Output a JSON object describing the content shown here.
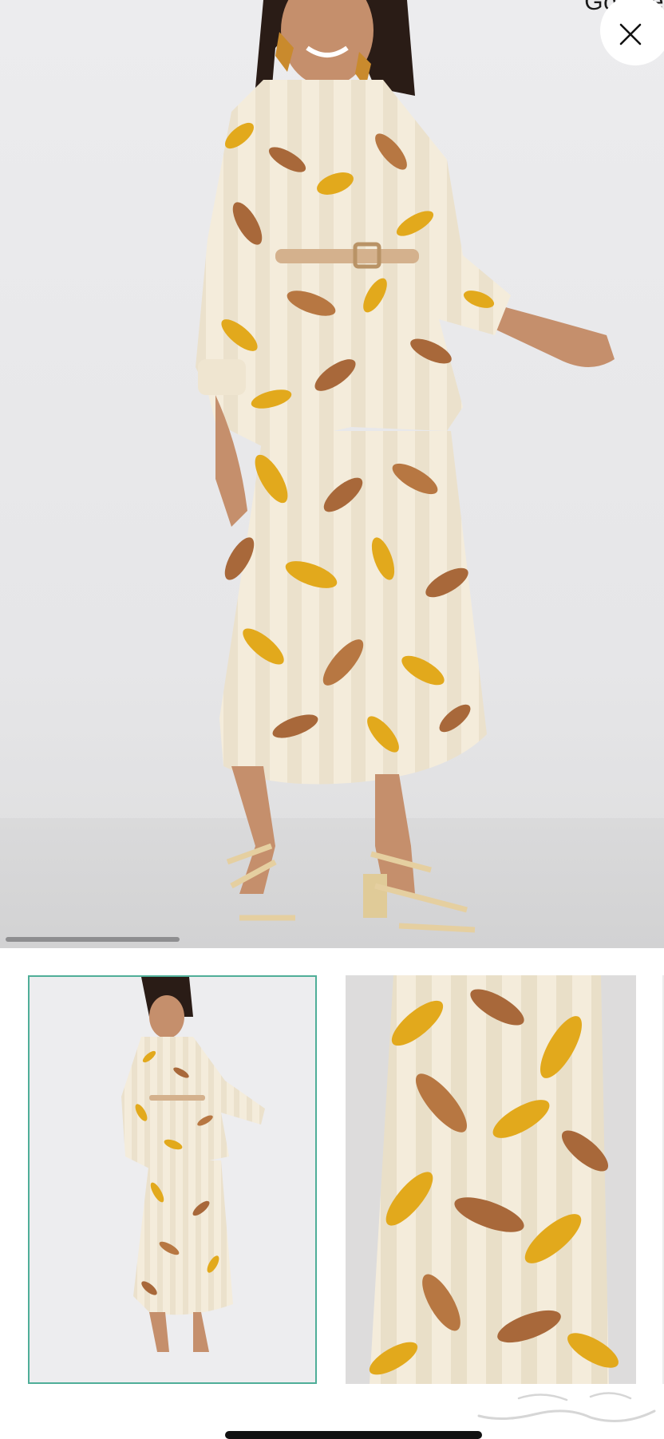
{
  "header": {
    "brand_text": "Google"
  },
  "close_button": {
    "icon": "close-icon"
  },
  "gallery": {
    "main_image": "product-photo-main",
    "thumbnails": [
      {
        "name": "thumbnail-full-outfit",
        "selected": true
      },
      {
        "name": "thumbnail-skirt-closeup",
        "selected": false
      },
      {
        "name": "thumbnail-next",
        "selected": false
      }
    ],
    "scroll_progress": 0.26
  },
  "watermark": {
    "text": "حراج"
  },
  "colors": {
    "selected_border": "#4fae98",
    "background": "#e8e8ea",
    "fabric_cream": "#f3ebd9",
    "leaf_gold": "#e2a91c",
    "leaf_brown": "#a8683a"
  }
}
